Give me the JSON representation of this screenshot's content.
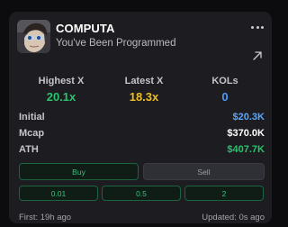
{
  "token": {
    "name": "COMPUTA",
    "subtitle": "You've Been Programmed"
  },
  "stats": [
    {
      "label": "Highest X",
      "value": "20.1x",
      "color": "#27c46b"
    },
    {
      "label": "Latest X",
      "value": "18.3x",
      "color": "#f0bd1f"
    },
    {
      "label": "KOLs",
      "value": "0",
      "color": "#4a9cf5"
    }
  ],
  "metrics": [
    {
      "label": "Initial",
      "value": "$20.3K",
      "color": "#5aa6f8"
    },
    {
      "label": "Mcap",
      "value": "$370.0K",
      "color": "#ffffff"
    },
    {
      "label": "ATH",
      "value": "$407.7K",
      "color": "#27c46b"
    }
  ],
  "actions": {
    "buy_label": "Buy",
    "sell_label": "Sell",
    "amounts": [
      "0.01",
      "0.5",
      "2"
    ]
  },
  "footer": {
    "first": "First: 19h ago",
    "updated": "Updated: 0s ago"
  },
  "icons": {
    "more": "more-dots-icon",
    "external": "external-link-arrow-icon"
  }
}
